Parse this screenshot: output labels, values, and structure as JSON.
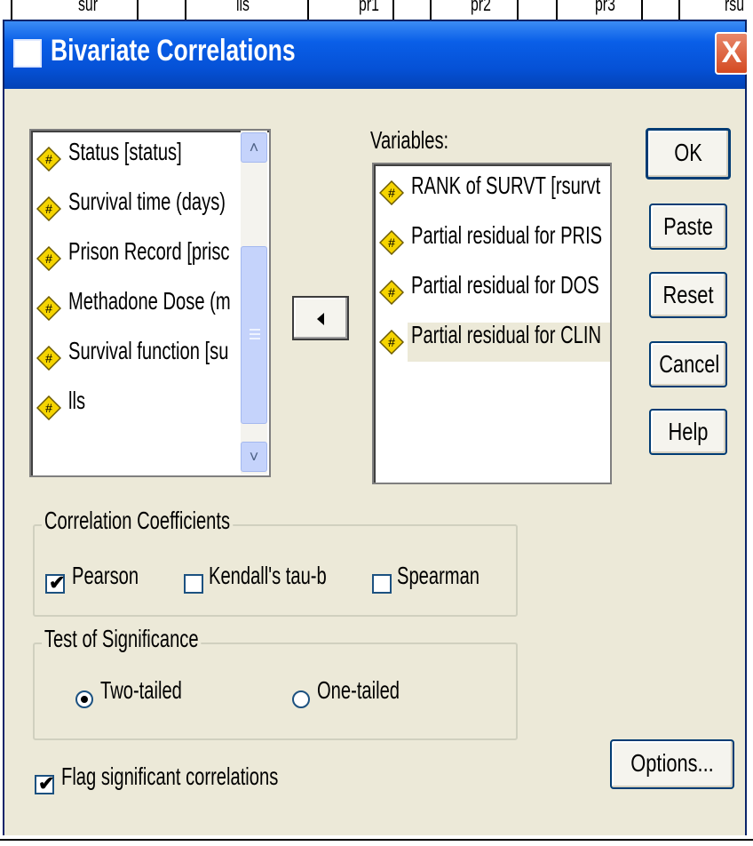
{
  "window": {
    "title": "Bivariate Correlations",
    "close_glyph": "X"
  },
  "background_columns": [
    "sur",
    "lls",
    "pr1",
    "pr2",
    "pr3",
    "rsu"
  ],
  "source_list": {
    "items": [
      {
        "label": "Status [status]",
        "icon": "numeric-variable-icon"
      },
      {
        "label": "Survival time (days)",
        "icon": "numeric-variable-icon"
      },
      {
        "label": "Prison Record [prisc",
        "icon": "numeric-variable-icon"
      },
      {
        "label": "Methadone Dose (m",
        "icon": "numeric-variable-icon"
      },
      {
        "label": "Survival function [su",
        "icon": "numeric-variable-icon"
      },
      {
        "label": "lls",
        "icon": "numeric-variable-icon"
      }
    ],
    "scroll_up_glyph": "˄",
    "scroll_down_glyph": "˅"
  },
  "variables": {
    "label": "Variables:",
    "items": [
      {
        "label": "RANK of SURVT [rsurvt",
        "icon": "numeric-variable-icon"
      },
      {
        "label": "Partial residual for PRIS",
        "icon": "numeric-variable-icon"
      },
      {
        "label": "Partial residual for DOS",
        "icon": "numeric-variable-icon"
      },
      {
        "label": "Partial residual for CLIN",
        "icon": "numeric-variable-icon"
      }
    ],
    "selected_index": 3
  },
  "buttons": {
    "ok": "OK",
    "paste": "Paste",
    "reset": "Reset",
    "cancel": "Cancel",
    "help": "Help",
    "options": "Options..."
  },
  "correlation_coefficients": {
    "title": "Correlation Coefficients",
    "pearson": {
      "label": "Pearson",
      "checked": true
    },
    "kendall": {
      "label": "Kendall's tau-b",
      "checked": false
    },
    "spearman": {
      "label": "Spearman",
      "checked": false
    }
  },
  "test_of_significance": {
    "title": "Test of Significance",
    "two_tailed": {
      "label": "Two-tailed",
      "selected": true
    },
    "one_tailed": {
      "label": "One-tailed",
      "selected": false
    }
  },
  "flag_significant": {
    "label": "Flag significant correlations",
    "checked": true
  },
  "colors": {
    "titlebar": "#0551d6",
    "dialog_bg": "#ece9d8",
    "close_button": "#d44a22",
    "icon_yellow": "#f5d400"
  }
}
